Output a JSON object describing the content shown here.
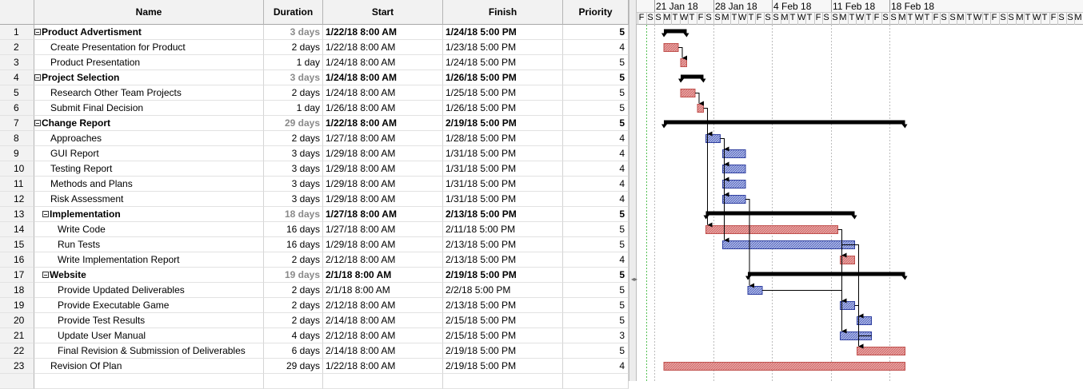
{
  "columns": {
    "name": "Name",
    "duration": "Duration",
    "start": "Start",
    "finish": "Finish",
    "priority": "Priority"
  },
  "tasks": [
    {
      "id": "1",
      "name": "Product Advertisment",
      "duration": "3 days",
      "start": "1/22/18 8:00 AM",
      "finish": "1/24/18 5:00 PM",
      "priority": "5"
    },
    {
      "id": "2",
      "name": "Create Presentation for Product",
      "duration": "2 days",
      "start": "1/22/18 8:00 AM",
      "finish": "1/23/18 5:00 PM",
      "priority": "4"
    },
    {
      "id": "3",
      "name": "Product Presentation",
      "duration": "1 day",
      "start": "1/24/18 8:00 AM",
      "finish": "1/24/18 5:00 PM",
      "priority": "5"
    },
    {
      "id": "4",
      "name": "Project Selection",
      "duration": "3 days",
      "start": "1/24/18 8:00 AM",
      "finish": "1/26/18 5:00 PM",
      "priority": "5"
    },
    {
      "id": "5",
      "name": "Research Other Team Projects",
      "duration": "2 days",
      "start": "1/24/18 8:00 AM",
      "finish": "1/25/18 5:00 PM",
      "priority": "5"
    },
    {
      "id": "6",
      "name": "Submit Final Decision",
      "duration": "1 day",
      "start": "1/26/18 8:00 AM",
      "finish": "1/26/18 5:00 PM",
      "priority": "5"
    },
    {
      "id": "7",
      "name": "Change Report",
      "duration": "29 days",
      "start": "1/22/18 8:00 AM",
      "finish": "2/19/18 5:00 PM",
      "priority": "5"
    },
    {
      "id": "8",
      "name": "Approaches",
      "duration": "2 days",
      "start": "1/27/18 8:00 AM",
      "finish": "1/28/18 5:00 PM",
      "priority": "4"
    },
    {
      "id": "9",
      "name": "GUI Report",
      "duration": "3 days",
      "start": "1/29/18 8:00 AM",
      "finish": "1/31/18 5:00 PM",
      "priority": "4"
    },
    {
      "id": "10",
      "name": "Testing Report",
      "duration": "3 days",
      "start": "1/29/18 8:00 AM",
      "finish": "1/31/18 5:00 PM",
      "priority": "4"
    },
    {
      "id": "11",
      "name": "Methods and Plans",
      "duration": "3 days",
      "start": "1/29/18 8:00 AM",
      "finish": "1/31/18 5:00 PM",
      "priority": "4"
    },
    {
      "id": "12",
      "name": "Risk Assessment",
      "duration": "3 days",
      "start": "1/29/18 8:00 AM",
      "finish": "1/31/18 5:00 PM",
      "priority": "4"
    },
    {
      "id": "13",
      "name": "Implementation",
      "duration": "18 days",
      "start": "1/27/18 8:00 AM",
      "finish": "2/13/18 5:00 PM",
      "priority": "5"
    },
    {
      "id": "14",
      "name": "Write Code",
      "duration": "16 days",
      "start": "1/27/18 8:00 AM",
      "finish": "2/11/18 5:00 PM",
      "priority": "5"
    },
    {
      "id": "15",
      "name": "Run Tests",
      "duration": "16 days",
      "start": "1/29/18 8:00 AM",
      "finish": "2/13/18 5:00 PM",
      "priority": "5"
    },
    {
      "id": "16",
      "name": "Write Implementation Report",
      "duration": "2 days",
      "start": "2/12/18 8:00 AM",
      "finish": "2/13/18 5:00 PM",
      "priority": "4"
    },
    {
      "id": "17",
      "name": "Website",
      "duration": "19 days",
      "start": "2/1/18 8:00 AM",
      "finish": "2/19/18 5:00 PM",
      "priority": "5"
    },
    {
      "id": "18",
      "name": "Provide Updated Deliverables",
      "duration": "2 days",
      "start": "2/1/18 8:00 AM",
      "finish": "2/2/18 5:00 PM",
      "priority": "5"
    },
    {
      "id": "19",
      "name": "Provide Executable Game",
      "duration": "2 days",
      "start": "2/12/18 8:00 AM",
      "finish": "2/13/18 5:00 PM",
      "priority": "5"
    },
    {
      "id": "20",
      "name": "Provide Test Results",
      "duration": "2 days",
      "start": "2/14/18 8:00 AM",
      "finish": "2/15/18 5:00 PM",
      "priority": "5"
    },
    {
      "id": "21",
      "name": "Update User Manual",
      "duration": "4 days",
      "start": "2/12/18 8:00 AM",
      "finish": "2/15/18 5:00 PM",
      "priority": "3"
    },
    {
      "id": "22",
      "name": "Final Revision & Submission of Deliverables",
      "duration": "6 days",
      "start": "2/14/18 8:00 AM",
      "finish": "2/19/18 5:00 PM",
      "priority": "5"
    },
    {
      "id": "23",
      "name": "Revision Of Plan",
      "duration": "29 days",
      "start": "1/22/18 8:00 AM",
      "finish": "2/19/18 5:00 PM",
      "priority": "4"
    }
  ],
  "timeline": {
    "weeks": [
      "21 Jan 18",
      "28 Jan 18",
      "4 Feb 18",
      "11 Feb 18",
      "18 Feb 18"
    ],
    "day_letters": [
      "F",
      "S",
      "S",
      "M",
      "T",
      "W",
      "T",
      "F",
      "S",
      "S",
      "M",
      "T",
      "W",
      "T",
      "F",
      "S",
      "S",
      "M",
      "T",
      "W",
      "T",
      "F",
      "S",
      "S",
      "M",
      "T",
      "W",
      "T",
      "F",
      "S",
      "S",
      "M",
      "T",
      "W",
      "T",
      "F",
      "S",
      "S",
      "M",
      "T",
      "W",
      "T",
      "F",
      "S",
      "S",
      "M",
      "T",
      "W",
      "T",
      "F",
      "S",
      "S",
      "M",
      "T",
      "W"
    ]
  },
  "colors": {
    "critical_fill": "#e8a0a0",
    "critical_border": "#c0504d",
    "normal_fill": "#a8b4e8",
    "normal_border": "#3040a0",
    "summary": "#000000",
    "today_line": "#55c055"
  }
}
